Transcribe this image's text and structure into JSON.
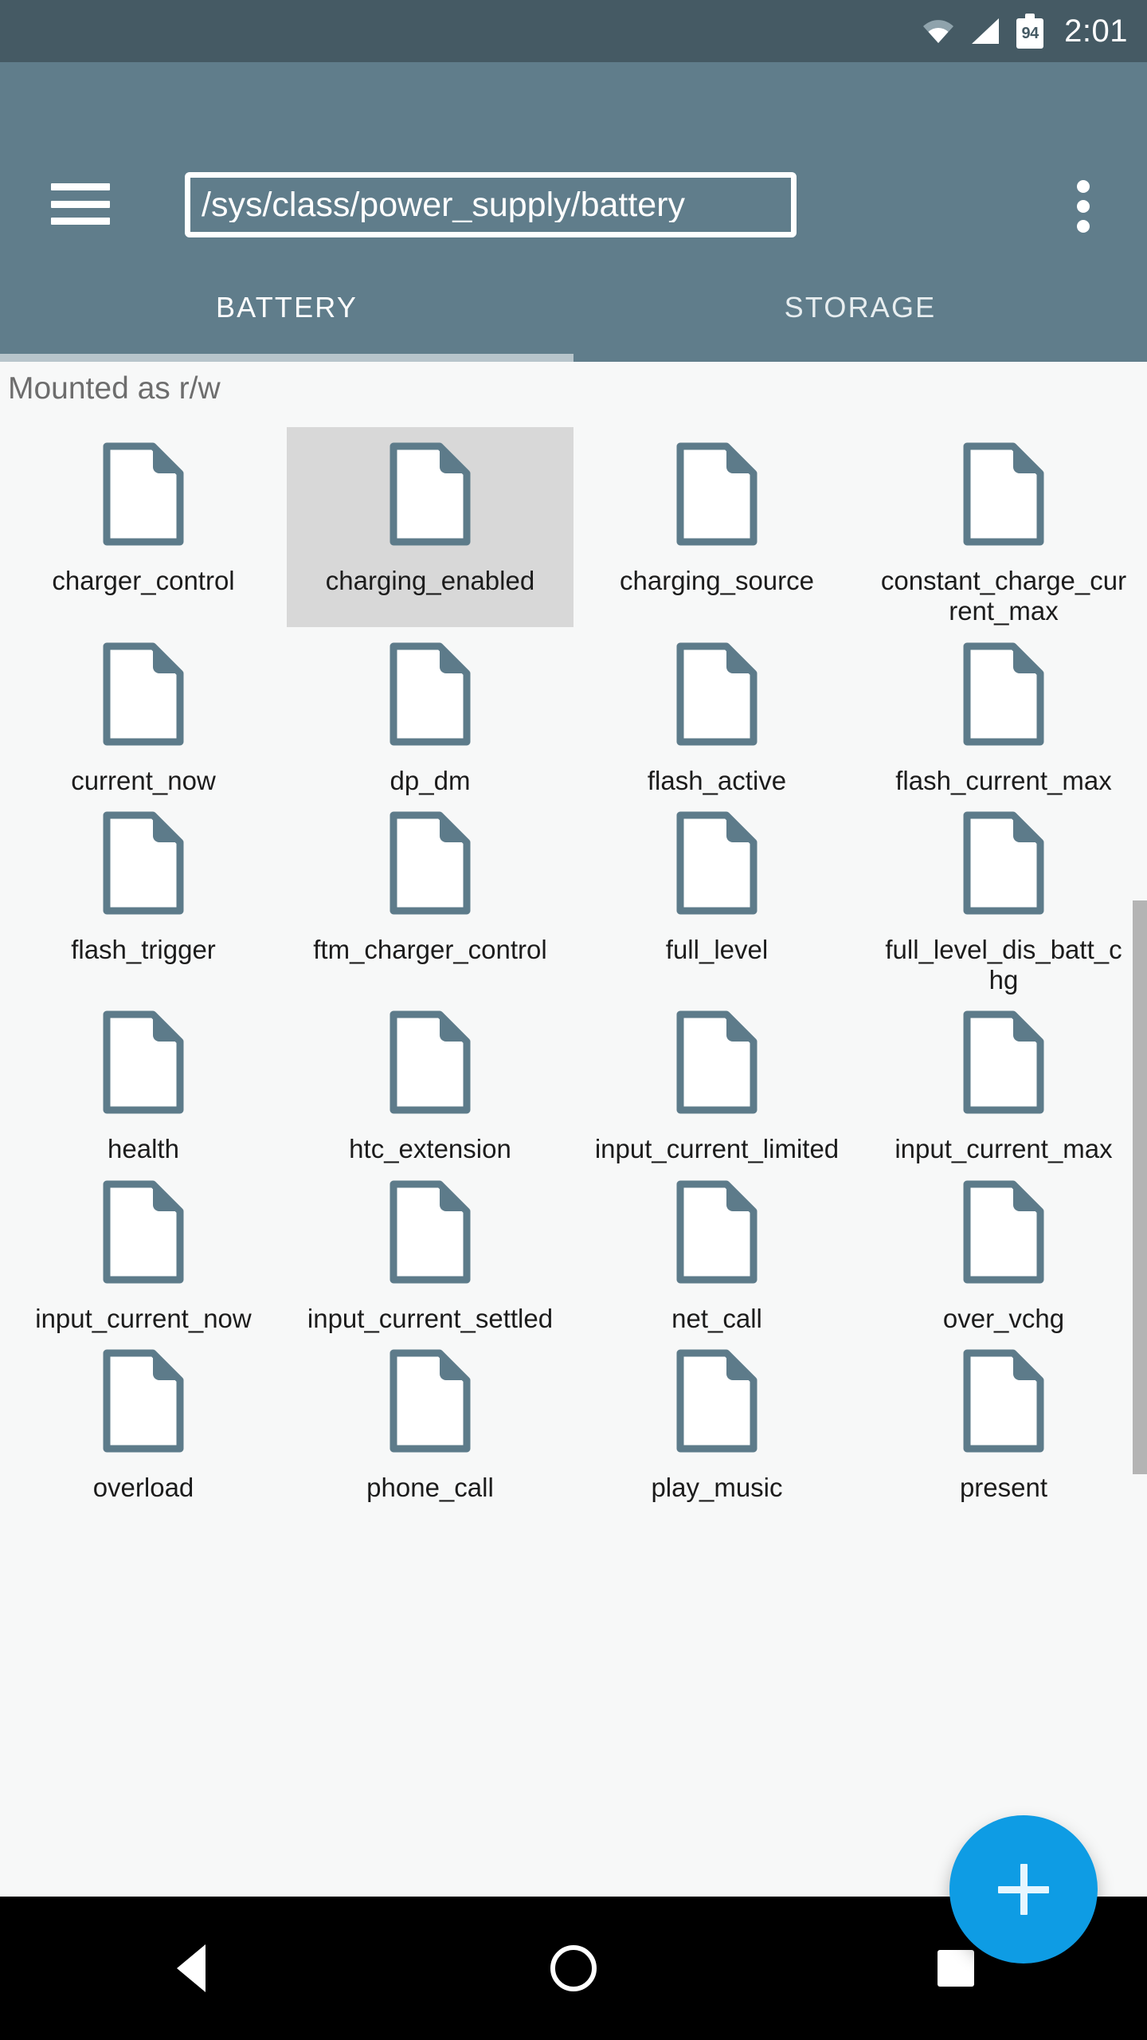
{
  "status_bar": {
    "wifi_icon": "wifi-icon",
    "signal_icon": "signal-icon",
    "battery_icon": "battery-icon",
    "battery_level": "94",
    "clock": "2:01"
  },
  "app_bar": {
    "menu_icon": "hamburger-menu-icon",
    "path_value": "/sys/class/power_supply/battery",
    "path_placeholder": "/",
    "overflow_icon": "overflow-menu-icon"
  },
  "tabs": [
    {
      "label": "BATTERY",
      "active": true
    },
    {
      "label": "STORAGE",
      "active": false
    }
  ],
  "content": {
    "mount_status": "Mounted as r/w",
    "files": [
      {
        "name": "charger_control",
        "selected": false
      },
      {
        "name": "charging_enabled",
        "selected": true
      },
      {
        "name": "charging_source",
        "selected": false
      },
      {
        "name": "constant_charge_current_max",
        "selected": false
      },
      {
        "name": "current_now",
        "selected": false
      },
      {
        "name": "dp_dm",
        "selected": false
      },
      {
        "name": "flash_active",
        "selected": false
      },
      {
        "name": "flash_current_max",
        "selected": false
      },
      {
        "name": "flash_trigger",
        "selected": false
      },
      {
        "name": "ftm_charger_control",
        "selected": false
      },
      {
        "name": "full_level",
        "selected": false
      },
      {
        "name": "full_level_dis_batt_chg",
        "selected": false
      },
      {
        "name": "health",
        "selected": false
      },
      {
        "name": "htc_extension",
        "selected": false
      },
      {
        "name": "input_current_limited",
        "selected": false
      },
      {
        "name": "input_current_max",
        "selected": false
      },
      {
        "name": "input_current_now",
        "selected": false
      },
      {
        "name": "input_current_settled",
        "selected": false
      },
      {
        "name": "net_call",
        "selected": false
      },
      {
        "name": "over_vchg",
        "selected": false
      },
      {
        "name": "overload",
        "selected": false
      },
      {
        "name": "phone_call",
        "selected": false
      },
      {
        "name": "play_music",
        "selected": false
      },
      {
        "name": "present",
        "selected": false
      }
    ]
  },
  "fab": {
    "icon": "plus-icon",
    "label": "+"
  },
  "nav_bar": {
    "back_icon": "back-triangle-icon",
    "home_icon": "home-circle-icon",
    "recents_icon": "recents-square-icon"
  },
  "colors": {
    "status_bar": "#455a64",
    "app_bar": "#607d8b",
    "accent_fab": "#0e9ce4",
    "file_icon": "#5d7b8a",
    "selection": "#d8d8d8",
    "content_bg": "#f7f8f8"
  }
}
